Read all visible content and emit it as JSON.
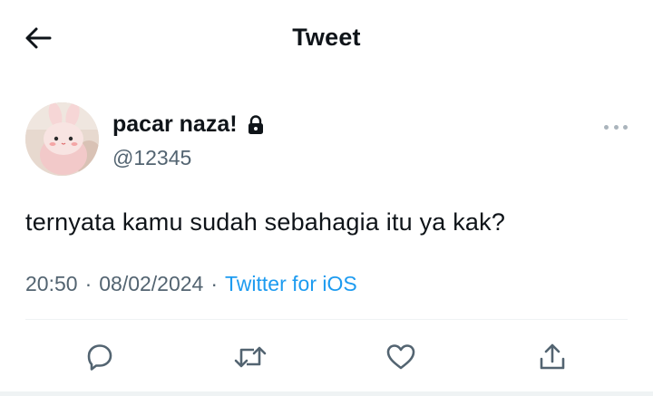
{
  "header": {
    "title": "Tweet",
    "back_icon": "arrow-left-icon"
  },
  "author": {
    "display_name": "pacar naza!",
    "handle": "@12345",
    "protected_icon": "lock-icon",
    "more_icon": "more-horizontal-icon"
  },
  "tweet": {
    "text": "ternyata kamu sudah sebahagia itu ya kak?",
    "time": "20:50",
    "separator": "·",
    "date": "08/02/2024",
    "source": "Twitter for iOS"
  },
  "actions": [
    {
      "name": "reply",
      "icon": "reply-icon"
    },
    {
      "name": "retweet",
      "icon": "retweet-icon"
    },
    {
      "name": "like",
      "icon": "heart-icon"
    },
    {
      "name": "share",
      "icon": "share-icon"
    }
  ],
  "colors": {
    "text_primary": "#0f1419",
    "text_secondary": "#536471",
    "accent": "#1d9bf0",
    "divider": "#eff3f4"
  }
}
